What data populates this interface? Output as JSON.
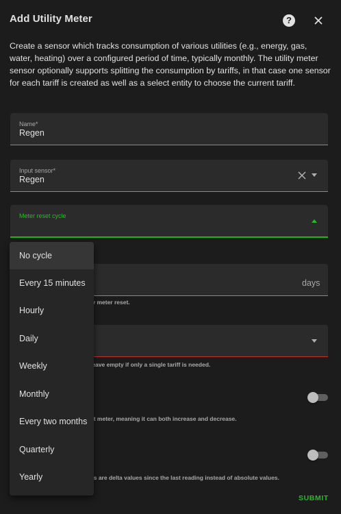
{
  "dialog": {
    "title": "Add Utility Meter",
    "help_icon": "help-circle-icon",
    "close_icon": "close-icon",
    "description": "Create a sensor which tracks consumption of various utilities (e.g., energy, gas, water, heating) over a configured period of time, typically monthly. The utility meter sensor optionally supports splitting the consumption by tariffs, in that case one sensor for each tariff is created as well as a select entity to choose the current tariff."
  },
  "form": {
    "name": {
      "label": "Name*",
      "value": "Regen"
    },
    "input_sensor": {
      "label": "Input sensor*",
      "value": "Regen"
    },
    "meter_reset_cycle": {
      "label": "Meter reset cycle",
      "value": ""
    },
    "offset": {
      "suffix": "days",
      "helper": "ly meter reset."
    },
    "tariffs": {
      "helper": "leave empty if only a single tariff is needed."
    },
    "net_consumption": {
      "helper": "et meter, meaning it can both increase and decrease.",
      "enabled": false
    },
    "delta_values": {
      "helper": "es are delta values since the last reading instead of absolute values.",
      "enabled": false
    },
    "submit_label": "SUBMIT"
  },
  "dropdown": {
    "selected_index": 0,
    "options": [
      "No cycle",
      "Every 15 minutes",
      "Hourly",
      "Daily",
      "Weekly",
      "Monthly",
      "Every two months",
      "Quarterly",
      "Yearly"
    ]
  },
  "colors": {
    "accent": "#20c020",
    "error": "#c0342c",
    "background": "#1c1c1c",
    "field": "#2b2b2b"
  }
}
